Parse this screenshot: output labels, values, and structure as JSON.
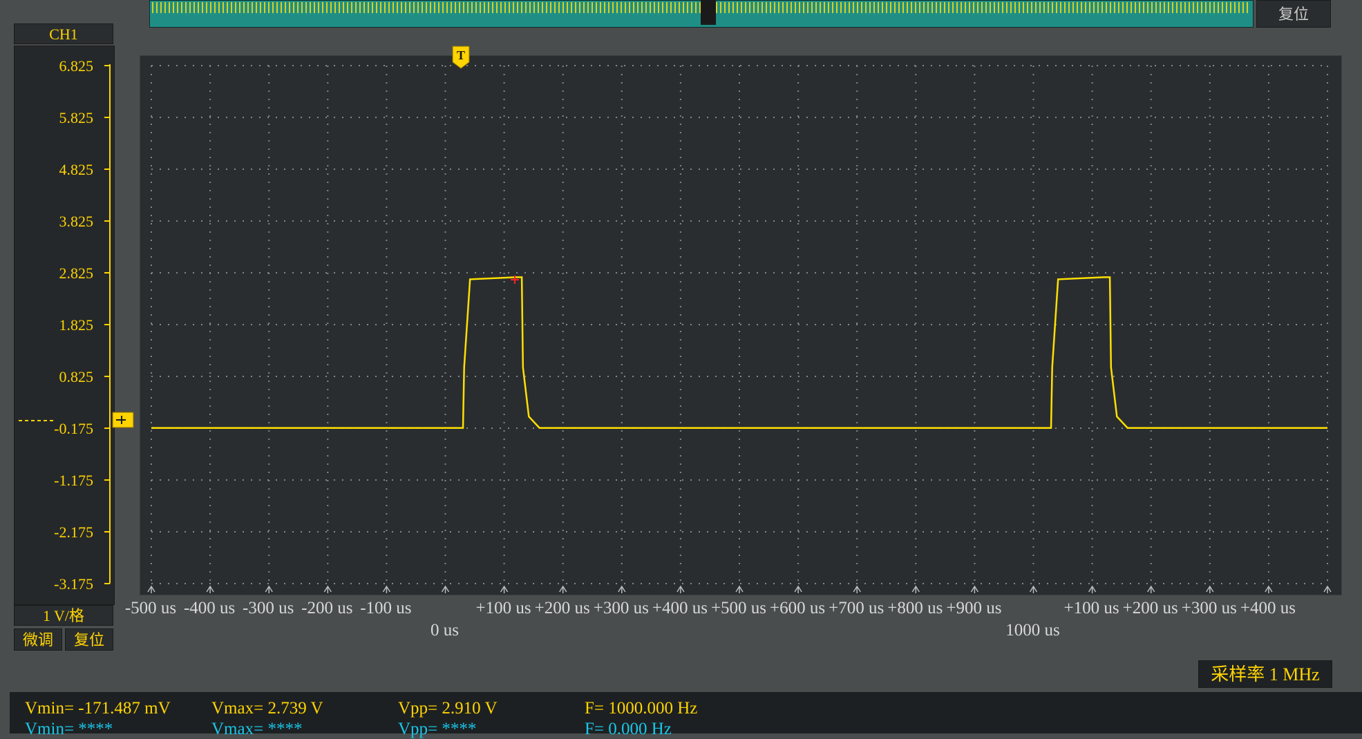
{
  "channel": {
    "name": "CH1",
    "volts_per_div": "1 V/格",
    "fine_label": "微调",
    "reset_label": "复位"
  },
  "top": {
    "reset_label": "复位"
  },
  "y_ticks": [
    "6.825",
    "5.825",
    "4.825",
    "3.825",
    "2.825",
    "1.825",
    "0.825",
    "-0.175",
    "-1.175",
    "-2.175",
    "-3.175"
  ],
  "x_ticks": [
    "-500 us",
    "-400 us",
    "-300 us",
    "-200 us",
    "-100 us",
    "+100 us",
    "+200 us",
    "+300 us",
    "+400 us",
    "+500 us",
    "+600 us",
    "+700 us",
    "+800 us",
    "+900 us",
    "+100 us",
    "+200 us",
    "+300 us",
    "+400 us"
  ],
  "x_markers": [
    "0 us",
    "1000 us"
  ],
  "trigger_marker": "T",
  "sample_rate": "采样率 1 MHz",
  "measurements": {
    "vmin": "Vmin= -171.487 mV",
    "vmax": "Vmax= 2.739 V",
    "vpp": "Vpp= 2.910 V",
    "freq": "F= 1000.000 Hz",
    "vmin2": "Vmin= ****",
    "vmax2": "Vmax= ****",
    "vpp2": "Vpp= ****",
    "freq2": "F= 0.000 Hz"
  },
  "colors": {
    "trace": "#ffe000",
    "label_yellow": "#ffd400",
    "cyan": "#19c6e8",
    "grid": "#7f8a8a"
  },
  "chart_data": {
    "type": "line",
    "x_unit": "us",
    "y_unit": "V",
    "xlim": [
      -530,
      1470
    ],
    "ylim": [
      -3.175,
      6.825
    ],
    "series": [
      {
        "x": [
          -530,
          0,
          2,
          12,
          90,
          100,
          102,
          112,
          130,
          1000,
          1002,
          1012,
          1090,
          1100,
          1102,
          1112,
          1130,
          1470
        ],
        "y": [
          -0.17,
          -0.17,
          1.0,
          2.7,
          2.739,
          2.739,
          1.0,
          0.05,
          -0.17,
          -0.17,
          1.0,
          2.7,
          2.739,
          2.739,
          1.0,
          0.05,
          -0.17,
          -0.17
        ]
      }
    ],
    "grid": true
  }
}
